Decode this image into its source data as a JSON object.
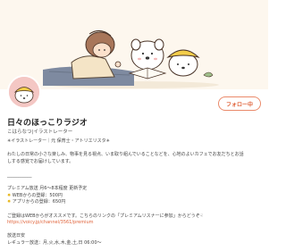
{
  "channel": {
    "title": "日々のほっこりラジオ",
    "subtitle": "こはらなつ|イラストレーター",
    "follow_label": "フォロー中"
  },
  "description": {
    "tagline": "✳︎イラストレーター｜元 保育士・アトリエリスタ✳︎",
    "body_1": "わたしの日常の小さな楽しみ、物事を見る視点、いま取り組んでいることなどを、心地のよいカフェでお友だちとお話",
    "body_2": "しする感覚でお届けしています。",
    "divider": "___________",
    "premium_title": "プレミアム放送 月6〜8本程度 更新予定",
    "premium_web": "WEBからの登録：500円",
    "premium_app": "アプリからの登録：650円",
    "recommend": "ご登録はWEBからがオススメです。こちらのリンクの「プレミアムリスナーに参加」からどうぞ",
    "link": "https://voicy.jp/channel/3561/premium",
    "schedule_title": "放送日安",
    "schedule_regular": "レギュラー放送：月,火,水,木,金,土,日 06:00〜"
  },
  "icons": {
    "web_star": "star-icon",
    "app_star": "star-icon",
    "hand": "pointing-hand-icon"
  },
  "colors": {
    "accent": "#e0633a",
    "header_bg": "#fdf7ee",
    "avatar_bg": "#f4c7c4"
  }
}
